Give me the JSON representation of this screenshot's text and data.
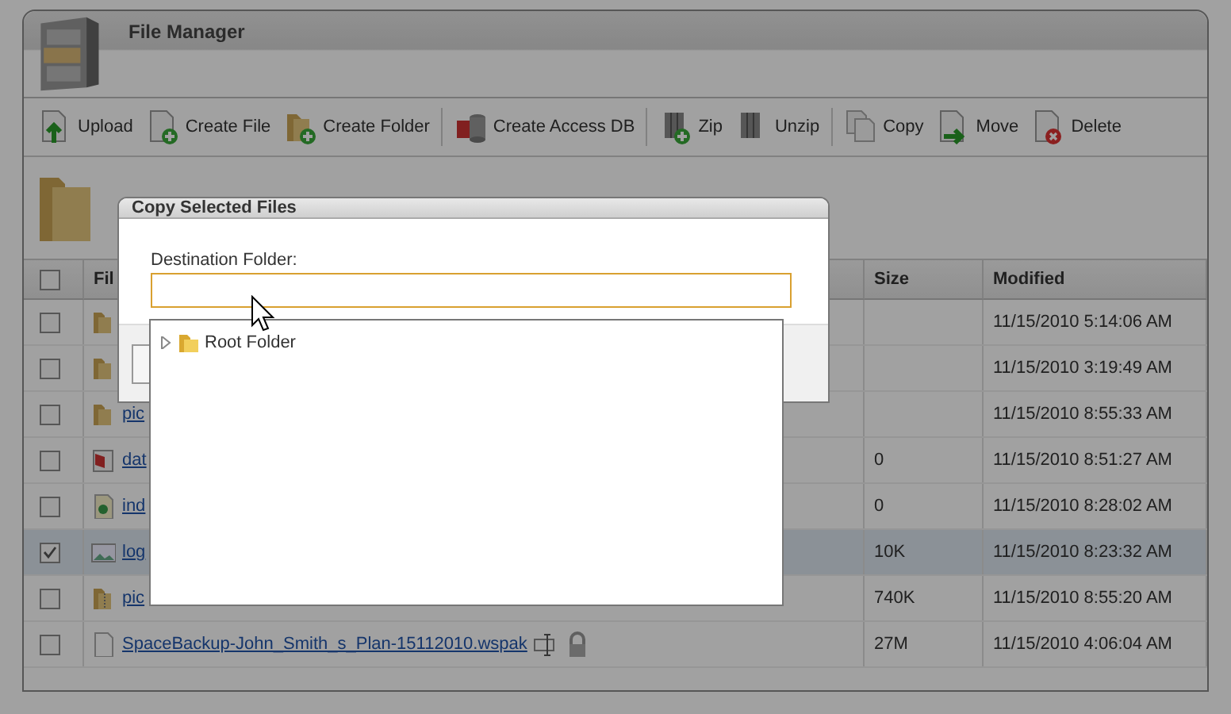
{
  "window": {
    "title": "File Manager"
  },
  "toolbar": [
    [
      {
        "kind": "upload",
        "label": "Upload"
      },
      {
        "kind": "new-file",
        "label": "Create File"
      },
      {
        "kind": "new-folder",
        "label": "Create Folder"
      }
    ],
    [
      {
        "kind": "database",
        "label": "Create Access DB"
      }
    ],
    [
      {
        "kind": "zip",
        "label": "Zip"
      },
      {
        "kind": "unzip",
        "label": "Unzip"
      }
    ],
    [
      {
        "kind": "copy",
        "label": "Copy"
      },
      {
        "kind": "move",
        "label": "Move"
      },
      {
        "kind": "delete",
        "label": "Delete"
      }
    ]
  ],
  "table": {
    "select_all": false,
    "columns": [
      "Fil",
      "Size",
      "Modified"
    ],
    "rows": [
      {
        "checked": false,
        "kind": "folder",
        "name": "",
        "size": "",
        "modified": "11/15/2010 5:14:06 AM"
      },
      {
        "checked": false,
        "kind": "folder",
        "name": "",
        "size": "",
        "modified": "11/15/2010 3:19:49 AM"
      },
      {
        "checked": false,
        "kind": "folder",
        "name": "pic",
        "size": "",
        "modified": "11/15/2010 8:55:33 AM"
      },
      {
        "checked": false,
        "kind": "database",
        "name": "dat",
        "size": "0",
        "modified": "11/15/2010 8:51:27 AM"
      },
      {
        "checked": false,
        "kind": "web",
        "name": "ind",
        "size": "0",
        "modified": "11/15/2010 8:28:02 AM"
      },
      {
        "checked": true,
        "kind": "image",
        "name": "log",
        "size": "10K",
        "modified": "11/15/2010 8:23:32 AM"
      },
      {
        "checked": false,
        "kind": "zip",
        "name": "pic",
        "size": "740K",
        "modified": "11/15/2010 8:55:20 AM"
      },
      {
        "checked": false,
        "kind": "file",
        "name": "SpaceBackup-John_Smith_s_Plan-15112010.wspak",
        "size": "27M",
        "modified": "11/15/2010 4:06:04 AM",
        "has_actions": true
      }
    ]
  },
  "dialog": {
    "title": "Copy Selected Files",
    "label": "Destination Folder:",
    "tree": [
      {
        "label": "Root Folder",
        "expanded": false
      }
    ]
  }
}
